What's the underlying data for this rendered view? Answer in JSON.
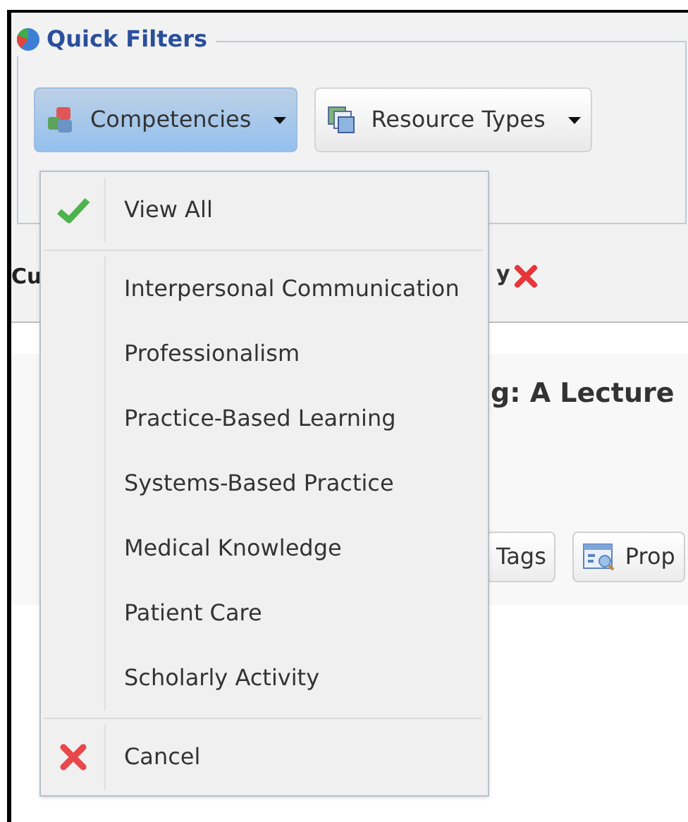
{
  "panel": {
    "title": "Quick Filters",
    "buttons": [
      {
        "label": "Competencies",
        "selected": true
      },
      {
        "label": "Resource Types",
        "selected": false
      }
    ]
  },
  "filter_bar": {
    "label": "Cu",
    "trailing_text": "y"
  },
  "content": {
    "title": "g: A Lecture",
    "buttons": [
      "Tags",
      "Prop"
    ]
  },
  "menu": {
    "items": [
      {
        "kind": "check",
        "label": "View All",
        "checked": true
      },
      {
        "kind": "separator"
      },
      {
        "kind": "check",
        "label": "Interpersonal Communication",
        "checked": false
      },
      {
        "kind": "check",
        "label": "Professionalism",
        "checked": false
      },
      {
        "kind": "check",
        "label": "Practice-Based Learning",
        "checked": false
      },
      {
        "kind": "check",
        "label": "Systems-Based Practice",
        "checked": false
      },
      {
        "kind": "check",
        "label": "Medical Knowledge",
        "checked": false
      },
      {
        "kind": "check",
        "label": "Patient Care",
        "checked": false
      },
      {
        "kind": "check",
        "label": "Scholarly Activity",
        "checked": false
      },
      {
        "kind": "separator"
      },
      {
        "kind": "cancel",
        "label": "Cancel"
      }
    ]
  }
}
